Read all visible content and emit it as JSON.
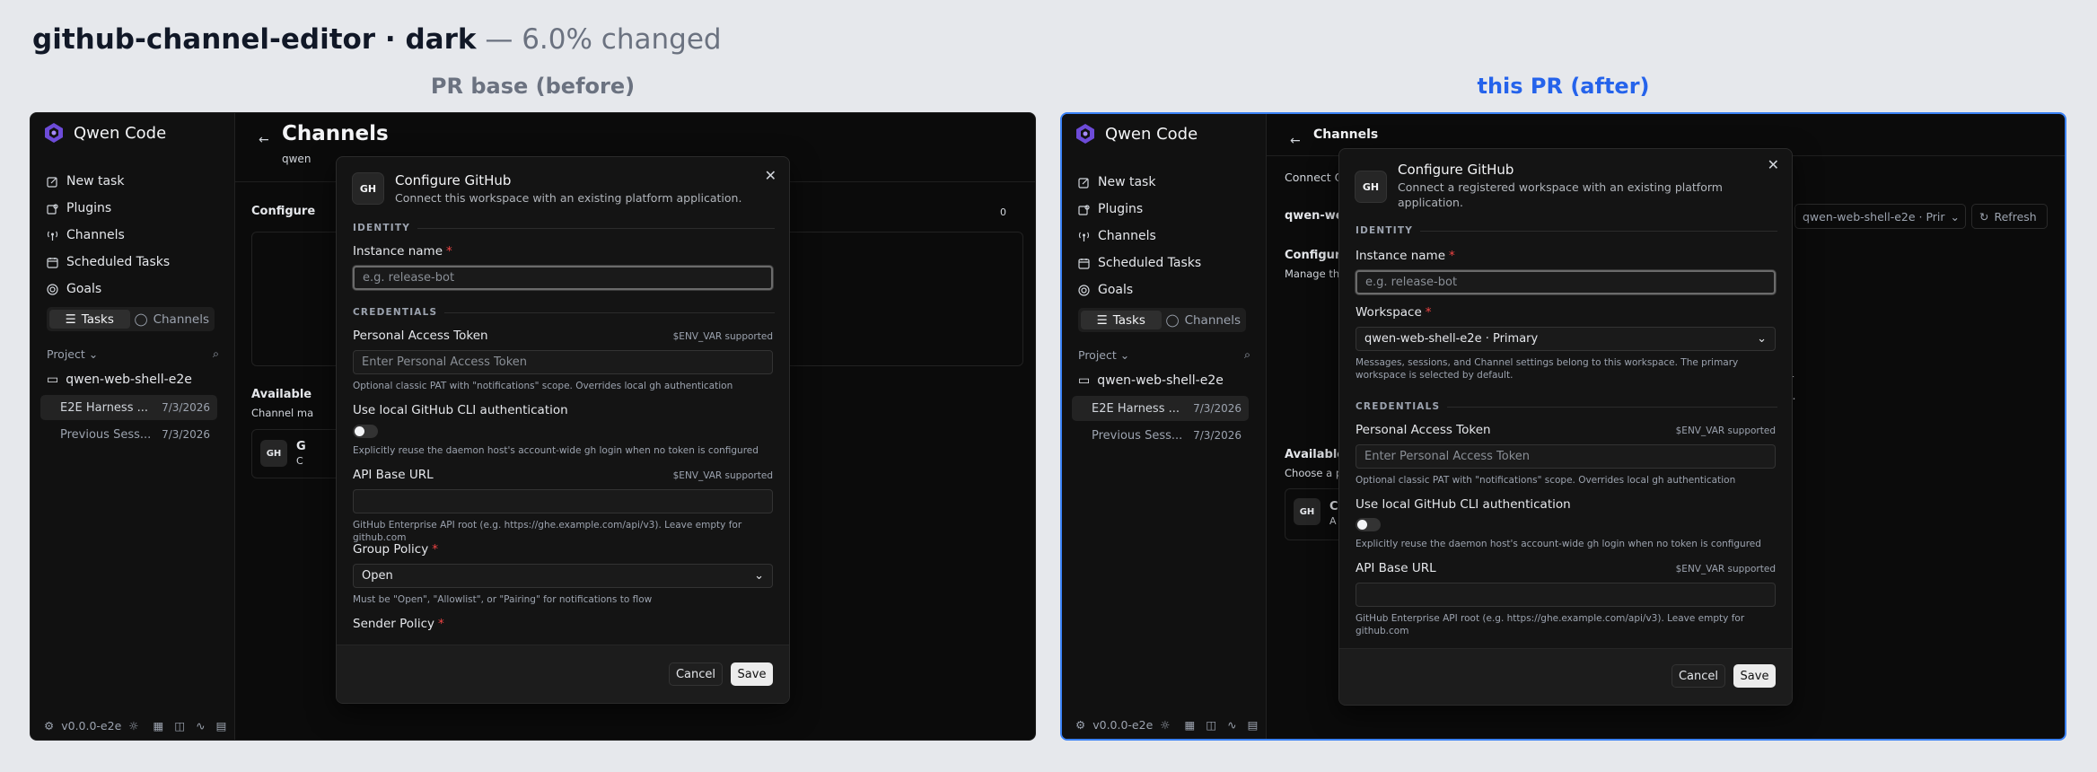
{
  "header": {
    "title": "github-channel-editor · dark",
    "subtitle": "— 6.0% changed"
  },
  "labels": {
    "before": "PR base (before)",
    "after": "this PR (after)"
  },
  "sidebar": {
    "app_name": "Qwen Code",
    "nav": [
      {
        "label": "New task",
        "icon": "edit-icon"
      },
      {
        "label": "Plugins",
        "icon": "puzzle-icon"
      },
      {
        "label": "Channels",
        "icon": "antenna-icon"
      },
      {
        "label": "Scheduled Tasks",
        "icon": "calendar-icon"
      },
      {
        "label": "Goals",
        "icon": "target-icon"
      }
    ],
    "seg_tasks": "Tasks",
    "seg_channels": "Channels",
    "project_label": "Project",
    "folder": "qwen-web-shell-e2e",
    "sessions": [
      {
        "title": "E2E Harness ...",
        "date": "7/3/2026"
      },
      {
        "title": "Previous Sess...",
        "date": "7/3/2026"
      }
    ],
    "version": "v0.0.0-e2e"
  },
  "before": {
    "page_title": "Channels",
    "bg": {
      "sub": "qwen",
      "configure": "Configure",
      "count": "0",
      "frag_r": "r",
      "frag_dot": "l.",
      "available": "Available",
      "channel_ma": "Channel ma",
      "card_g": "G",
      "card_c": "C"
    },
    "modal": {
      "title": "Configure GitHub",
      "desc": "Connect this workspace with an existing platform application.",
      "identity": "IDENTITY",
      "instance_label": "Instance name",
      "instance_placeholder": "e.g. release-bot",
      "credentials": "CREDENTIALS",
      "pat_label": "Personal Access Token",
      "env_supported": "$ENV_VAR supported",
      "pat_placeholder": "Enter Personal Access Token",
      "pat_help": "Optional classic PAT with \"notifications\" scope. Overrides local gh authentication",
      "cli_label": "Use local GitHub CLI authentication",
      "cli_help": "Explicitly reuse the daemon host's account-wide gh login when no token is configured",
      "api_label": "API Base URL",
      "api_help": "GitHub Enterprise API root (e.g. https://ghe.example.com/api/v3). Leave empty for github.com",
      "group_label": "Group Policy",
      "group_value": "Open",
      "group_help": "Must be \"Open\", \"Allowlist\", or \"Pairing\" for notifications to flow",
      "sender_label": "Sender Policy",
      "cancel": "Cancel",
      "save": "Save"
    }
  },
  "after": {
    "page_title": "Channels",
    "bg": {
      "connect": "Connect Q",
      "qwen_we": "qwen-we",
      "workspace_pill": "qwen-web-shell-e2e · Prir",
      "refresh": "Refresh",
      "configure": "Configur",
      "manage": "Manage the",
      "frag_r": "r",
      "frag_dot": "l.",
      "available": "Available",
      "choose": "Choose a p",
      "card_g": "G",
      "card_c": "C",
      "card_a": "A"
    },
    "modal": {
      "title": "Configure GitHub",
      "desc": "Connect a registered workspace with an existing platform application.",
      "identity": "IDENTITY",
      "instance_label": "Instance name",
      "instance_placeholder": "e.g. release-bot",
      "workspace_label": "Workspace",
      "workspace_value": "qwen-web-shell-e2e · Primary",
      "workspace_help": "Messages, sessions, and Channel settings belong to this workspace. The primary workspace is selected by default.",
      "credentials": "CREDENTIALS",
      "pat_label": "Personal Access Token",
      "env_supported": "$ENV_VAR supported",
      "pat_placeholder": "Enter Personal Access Token",
      "pat_help": "Optional classic PAT with \"notifications\" scope. Overrides local gh authentication",
      "cli_label": "Use local GitHub CLI authentication",
      "cli_help": "Explicitly reuse the daemon host's account-wide gh login when no token is configured",
      "api_label": "API Base URL",
      "api_help": "GitHub Enterprise API root (e.g. https://ghe.example.com/api/v3). Leave empty for github.com",
      "cancel": "Cancel",
      "save": "Save"
    }
  }
}
